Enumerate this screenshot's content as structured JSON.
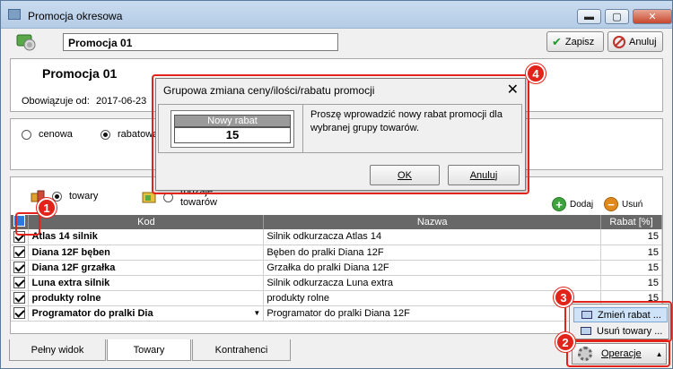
{
  "window": {
    "title": "Promocja okresowa",
    "controls": {
      "minimize": "▬",
      "maximize": "▢",
      "close": "✕"
    }
  },
  "toolbar": {
    "promo_name": "Promocja 01",
    "save_label": "Zapisz",
    "cancel_label": "Anuluj"
  },
  "header_panel": {
    "title": "Promocja 01",
    "valid_from_label": "Obowiązuje od:",
    "valid_from_value": "2017-06-23"
  },
  "type_panel": {
    "option_price": "cenowa",
    "option_discount": "rabatowa",
    "selected": "rabatowa"
  },
  "grid_panel": {
    "tab_goods": "towary",
    "tab_goods_types": "rodzaje towarów",
    "add_label": "Dodaj",
    "remove_label": "Usuń",
    "columns": {
      "code": "Kod",
      "name": "Nazwa",
      "discount": "Rabat [%]"
    },
    "rows": [
      {
        "checked": true,
        "code": "Atlas 14 silnik",
        "name": "Silnik odkurzacza Atlas 14",
        "discount": "15"
      },
      {
        "checked": true,
        "code": "Diana 12F bęben",
        "name": "Bęben do pralki Diana 12F",
        "discount": "15"
      },
      {
        "checked": true,
        "code": "Diana 12F grzałka",
        "name": "Grzałka do pralki Diana 12F",
        "discount": "15"
      },
      {
        "checked": true,
        "code": "Luna extra silnik",
        "name": "Silnik odkurzacza Luna extra",
        "discount": "15"
      },
      {
        "checked": true,
        "code": "produkty rolne",
        "name": "produkty rolne",
        "discount": "15"
      },
      {
        "checked": true,
        "code": "Programator do pralki Dia",
        "name": "Programator do pralki Diana 12F",
        "discount": "15"
      }
    ]
  },
  "bottom_tabs": {
    "full_view": "Pełny widok",
    "goods": "Towary",
    "contractors": "Kontrahenci",
    "active": "Towary"
  },
  "operations_menu": {
    "button_label": "Operacje",
    "items": [
      "Zmień rabat ...",
      "Usuń towary ..."
    ]
  },
  "dialog": {
    "title": "Grupowa zmiana ceny/ilości/rabatu promocji",
    "field_label": "Nowy rabat",
    "field_value": "15",
    "message": "Proszę wprowadzić nowy rabat promocji dla wybranej grupy towarów.",
    "ok_label": "OK",
    "cancel_label": "Anuluj"
  },
  "annotations": [
    "1",
    "2",
    "3",
    "4"
  ],
  "colors": {
    "annotation": "#e2231a",
    "grid_header": "#686868",
    "selection": "#cfe3f8"
  }
}
